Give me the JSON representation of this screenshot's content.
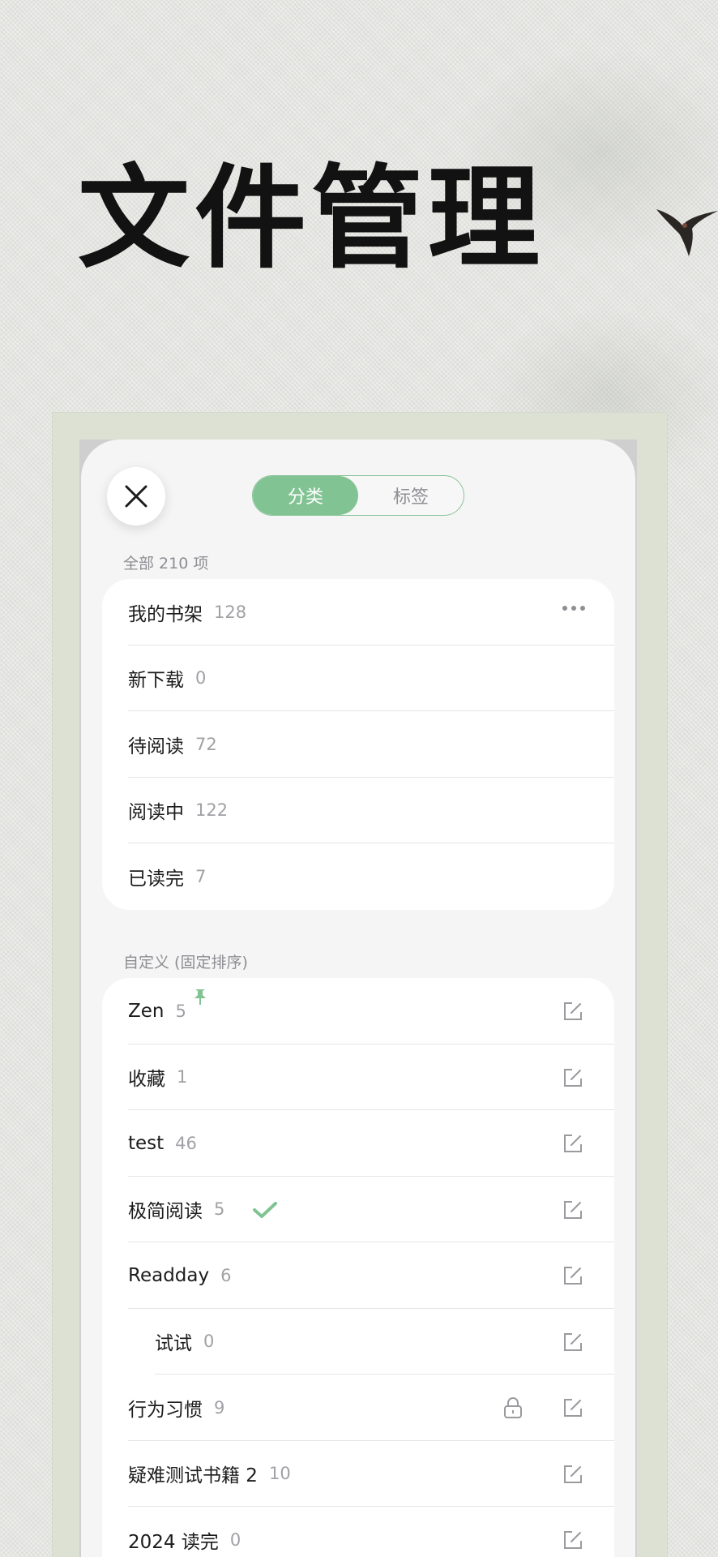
{
  "page_title": "文件管理",
  "accent_color": "#82c393",
  "segmented": {
    "active": "分类",
    "inactive": "标签"
  },
  "all_section": {
    "header": "全部 210 项",
    "items": [
      {
        "label": "我的书架",
        "count": "128"
      },
      {
        "label": "新下载",
        "count": "0"
      },
      {
        "label": "待阅读",
        "count": "72"
      },
      {
        "label": "阅读中",
        "count": "122"
      },
      {
        "label": "已读完",
        "count": "7"
      }
    ]
  },
  "custom_section": {
    "header": "自定义 (固定排序)",
    "items": [
      {
        "label": "Zen",
        "count": "5",
        "pinned": true
      },
      {
        "label": "收藏",
        "count": "1"
      },
      {
        "label": "test",
        "count": "46"
      },
      {
        "label": "极简阅读",
        "count": "5",
        "selected": true
      },
      {
        "label": "Readday",
        "count": "6"
      },
      {
        "label": "试试",
        "count": "0",
        "indented": true
      },
      {
        "label": "行为习惯",
        "count": "9",
        "locked": true
      },
      {
        "label": "疑难测试书籍 2",
        "count": "10"
      },
      {
        "label": "2024 读完",
        "count": "0"
      }
    ]
  },
  "icons": [
    "close-icon",
    "more-icon",
    "edit-icon",
    "pin-icon",
    "checkmark-icon",
    "lock-icon",
    "swallow-bird-icon"
  ]
}
